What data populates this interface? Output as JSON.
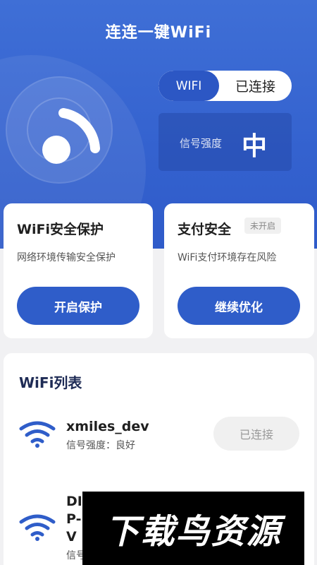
{
  "app": {
    "title": "连连一键WiFi"
  },
  "status": {
    "toggle_left": "WIFI",
    "toggle_right": "已连接",
    "signal_label": "信号强度",
    "signal_value": "中"
  },
  "cards": [
    {
      "title": "WiFi安全保护",
      "subtitle": "网络环境传输安全保护",
      "button": "开启保护"
    },
    {
      "title": "支付安全",
      "badge": "未开启",
      "subtitle": "WiFi支付环境存在风险",
      "button": "继续优化"
    }
  ],
  "wifi_list": {
    "title": "WiFi列表",
    "items": [
      {
        "name": "xmiles_dev",
        "signal": "信号强度：良好",
        "action": "已连接"
      },
      {
        "name": "DI P- V",
        "signal": "信号强度：良好"
      }
    ]
  },
  "watermark": {
    "text": "下载鸟资源"
  },
  "colors": {
    "primary": "#2f5dc9",
    "hero": "#3a68d3"
  },
  "icons": [
    "wifi-icon",
    "radar-icon"
  ]
}
